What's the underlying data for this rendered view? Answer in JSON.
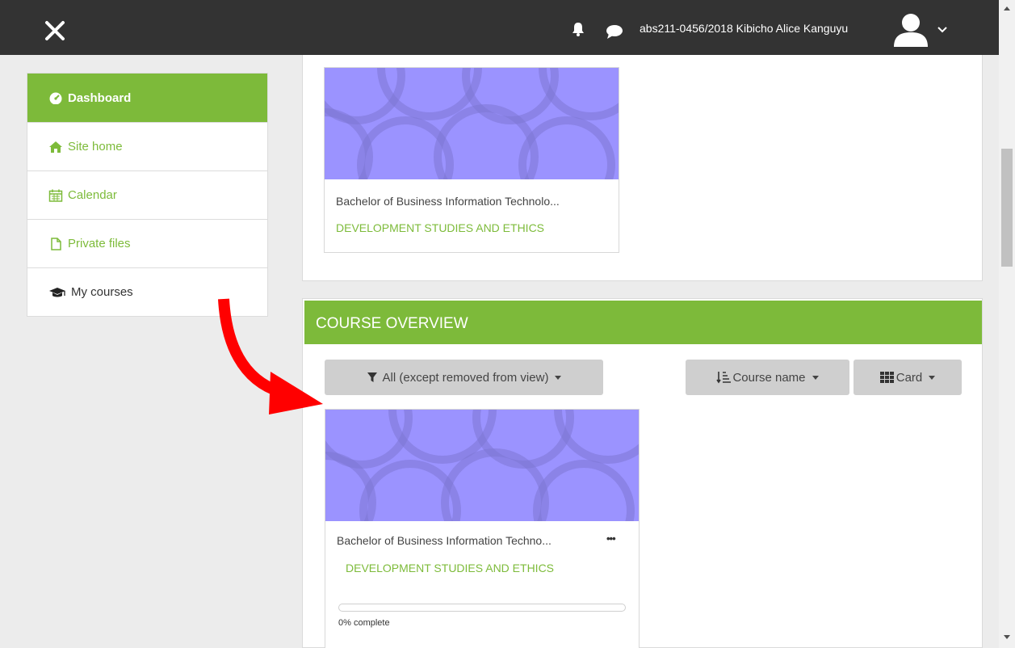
{
  "navbar": {
    "user_name": "abs211-0456/2018 Kibicho Alice Kanguyu",
    "icons": [
      "close-icon",
      "bell-icon",
      "chat-icon",
      "user-avatar-icon",
      "chevron-down-icon"
    ]
  },
  "sidebar": {
    "items": [
      {
        "label": "Dashboard",
        "icon": "dashboard-icon"
      },
      {
        "label": "Site home",
        "icon": "home-icon"
      },
      {
        "label": "Calendar",
        "icon": "calendar-icon"
      },
      {
        "label": "Private files",
        "icon": "file-icon"
      },
      {
        "label": "My courses",
        "icon": "graduation-cap-icon"
      }
    ]
  },
  "top_card": {
    "title": "Bachelor of Business Information Technolo...",
    "category": "DEVELOPMENT STUDIES AND ETHICS"
  },
  "overview": {
    "heading": "COURSE OVERVIEW",
    "filter_label": "All (except removed from view)",
    "sort_label": "Course name",
    "view_label": "Card",
    "course": {
      "title": "Bachelor of Business Information Techno...",
      "category": "DEVELOPMENT STUDIES AND ETHICS",
      "progress_text": "0% complete",
      "progress": 0
    }
  },
  "colors": {
    "navbar": "#333333",
    "accent_green": "#7dba3a",
    "course_image": "#9b93ff",
    "annotation_arrow": "#ff0000"
  }
}
